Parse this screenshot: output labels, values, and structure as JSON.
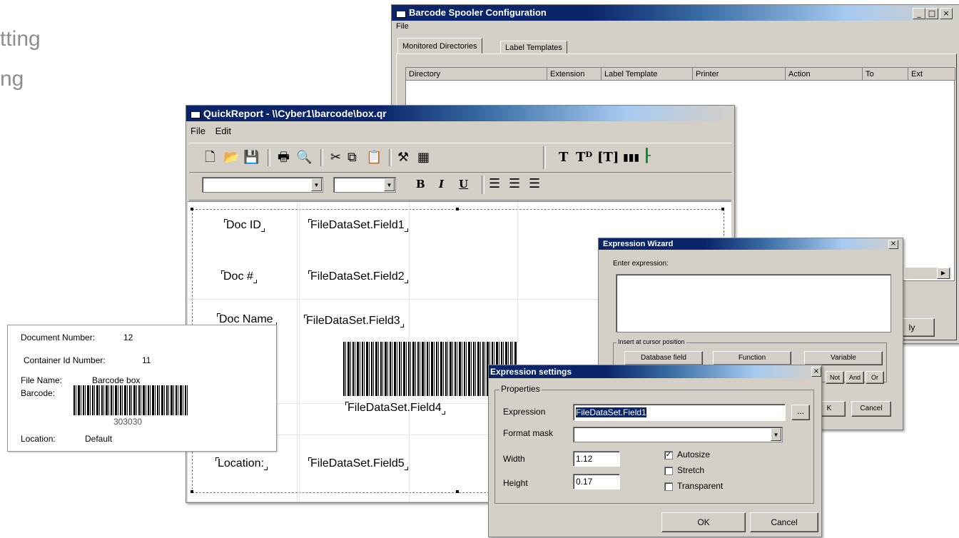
{
  "background": {
    "lines": [
      "tting",
      "ng"
    ]
  },
  "spooler": {
    "title": "Barcode Spooler Configuration",
    "menu": [
      "File"
    ],
    "tabs": [
      "Monitored Directories",
      "Label Templates"
    ],
    "columns": [
      "Directory",
      "Extension",
      "Label Template",
      "Printer",
      "Action",
      "To",
      "Ext"
    ],
    "controls": {
      "min": "_",
      "max": "□",
      "close": "×"
    },
    "partial_button": "ly"
  },
  "quickreport": {
    "title": "QuickReport - \\\\Cyber1\\barcode\\box.qr",
    "menu": [
      "File",
      "Edit"
    ],
    "format_buttons": {
      "bold": "B",
      "italic": "I",
      "underline": "U"
    },
    "labels": {
      "doc_id": "Doc ID",
      "doc_num": "Doc #",
      "doc_name": "Doc Name",
      "location": "Location:"
    },
    "fields": {
      "f1": "FileDataSet.Field1",
      "f2": "FileDataSet.Field2",
      "f3": "FileDataSet.Field3",
      "f4": "FileDataSet.Field4",
      "f5": "FileDataSet.Field5"
    }
  },
  "label_preview": {
    "document_number_label": "Document Number:",
    "document_number_value": "12",
    "container_label": "Container Id Number:",
    "container_value": "11",
    "file_name_label": "File Name:",
    "file_name_value": "Barcode box",
    "barcode_label": "Barcode:",
    "barcode_value": "303030",
    "location_label": "Location:",
    "location_value": "Default"
  },
  "expression_wizard": {
    "title": "Expression Wizard",
    "enter_label": "Enter expression:",
    "group_label": "Insert at cursor position",
    "buttons": [
      "Database field",
      "Function",
      "Variable"
    ],
    "ops": [
      "Not",
      "And",
      "Or"
    ],
    "ok_partial": "K",
    "cancel": "Cancel",
    "close": "×"
  },
  "expression_settings": {
    "title": "Expression settings",
    "group_label": "Properties",
    "expression_label": "Expression",
    "expression_value": "FileDataSet.Field1",
    "ellipsis": "...",
    "format_label": "Format mask",
    "format_value": "",
    "width_label": "Width",
    "width_value": "1.12",
    "height_label": "Height",
    "height_value": "0.17",
    "autosize_label": "Autosize",
    "autosize_checked": true,
    "stretch_label": "Stretch",
    "stretch_checked": false,
    "transparent_label": "Transparent",
    "transparent_checked": false,
    "ok": "OK",
    "cancel": "Cancel",
    "close": "×"
  }
}
